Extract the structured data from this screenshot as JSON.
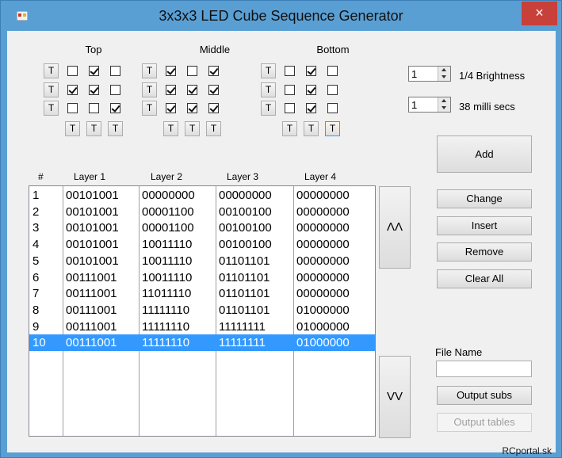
{
  "window": {
    "title": "3x3x3 LED Cube Sequence Generator",
    "close_symbol": "×",
    "footer": "RCportal.sk"
  },
  "groups": [
    {
      "title": "Top",
      "rows": [
        [
          false,
          true,
          false
        ],
        [
          true,
          true,
          false
        ],
        [
          false,
          false,
          true
        ]
      ],
      "row_button_label": "T",
      "col_button_label": "T"
    },
    {
      "title": "Middle",
      "rows": [
        [
          true,
          false,
          true
        ],
        [
          true,
          true,
          true
        ],
        [
          true,
          true,
          true
        ]
      ],
      "row_button_label": "T",
      "col_button_label": "T"
    },
    {
      "title": "Bottom",
      "rows": [
        [
          false,
          true,
          false
        ],
        [
          false,
          true,
          false
        ],
        [
          false,
          true,
          false
        ]
      ],
      "row_button_label": "T",
      "col_button_label": "T"
    }
  ],
  "controls": {
    "brightness_value": "1",
    "brightness_label": "1/4 Brightness",
    "delay_value": "1",
    "delay_label": "38 milli secs"
  },
  "buttons": {
    "add": "Add",
    "change": "Change",
    "insert": "Insert",
    "remove": "Remove",
    "clear_all": "Clear All",
    "move_up": "ΛΛ",
    "move_down": "VV",
    "output_subs": "Output subs",
    "output_tables": "Output tables"
  },
  "file": {
    "label": "File Name",
    "value": ""
  },
  "list": {
    "columns": [
      "#",
      "Layer 1",
      "Layer 2",
      "Layer 3",
      "Layer 4"
    ],
    "rows": [
      [
        "1",
        "00101001",
        "00000000",
        "00000000",
        "00000000"
      ],
      [
        "2",
        "00101001",
        "00001100",
        "00100100",
        "00000000"
      ],
      [
        "3",
        "00101001",
        "00001100",
        "00100100",
        "00000000"
      ],
      [
        "4",
        "00101001",
        "10011110",
        "00100100",
        "00000000"
      ],
      [
        "5",
        "00101001",
        "10011110",
        "01101101",
        "00000000"
      ],
      [
        "6",
        "00111001",
        "10011110",
        "01101101",
        "00000000"
      ],
      [
        "7",
        "00111001",
        "11011110",
        "01101101",
        "00000000"
      ],
      [
        "8",
        "00111001",
        "11111110",
        "01101101",
        "01000000"
      ],
      [
        "9",
        "00111001",
        "11111110",
        "11111111",
        "01000000"
      ],
      [
        "10",
        "00111001",
        "11111110",
        "11111111",
        "01000000"
      ]
    ],
    "selected_index": 9
  },
  "colors": {
    "selection": "#3399ff",
    "close_button": "#c7403a",
    "title_bar": "#5a9fd4"
  }
}
